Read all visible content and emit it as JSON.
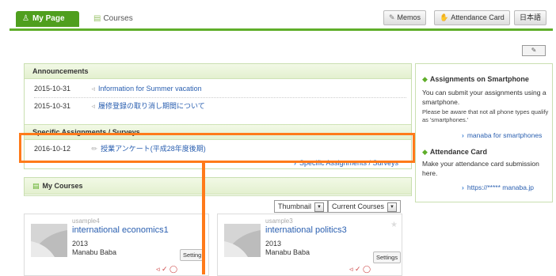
{
  "topbar": {
    "tab_my_page": "My Page",
    "tab_courses": "Courses",
    "memos": "Memos",
    "attendance_card": "Attendance Card",
    "language": "日本語"
  },
  "announcements": {
    "title": "Announcements",
    "items": [
      {
        "date": "2015-10-31",
        "text": "Information for Summer vacation"
      },
      {
        "date": "2015-10-31",
        "text": "履修登録の取り消し期間について"
      }
    ]
  },
  "assignments": {
    "title": "Specific Assignments / Surveys",
    "items": [
      {
        "date": "2016-10-12",
        "text": "授業アンケート(平成28年度後期)"
      }
    ],
    "more_link": "Specific Assignments / Surveys"
  },
  "side": {
    "smartphone_title": "Assignments on Smartphone",
    "smartphone_text": "You can submit your assignments using a smartphone.",
    "smartphone_note": "Please be aware that not all phone types qualify as 'smartphones.'",
    "smartphone_link": "manaba for smartphones",
    "attendance_title": "Attendance Card",
    "attendance_text": "Make your attendance card submission here.",
    "attendance_link": "https://***** manaba.jp"
  },
  "courses": {
    "title": "My Courses",
    "view_select": "Thumbnail",
    "filter_select": "Current Courses",
    "cards": [
      {
        "user": "usample4",
        "title": "international economics1",
        "year": "2013",
        "teacher": "Manabu Baba",
        "settings": "Setting"
      },
      {
        "user": "usample3",
        "title": "international politics3",
        "year": "2013",
        "teacher": "Manabu Baba",
        "settings": "Settings"
      }
    ]
  },
  "colors": {
    "accent_green": "#4f9f1e",
    "highlight_orange": "#ff7a1a",
    "link_blue": "#2a5fb0"
  }
}
